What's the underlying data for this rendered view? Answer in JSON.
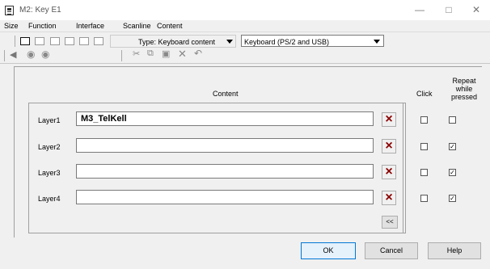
{
  "window": {
    "title": "M2: Key E1",
    "minimize": "—",
    "maximize": "□",
    "close": "✕"
  },
  "menu": {
    "size": "Size",
    "function": "Function",
    "interface": "Interface",
    "scanline": "Scanline",
    "content": "Content"
  },
  "toolbar": {
    "type_label": "Type: Keyboard content",
    "keyboard_select": "Keyboard (PS/2 and USB)"
  },
  "headers": {
    "content": "Content",
    "click": "Click",
    "repeat": "Repeat while pressed"
  },
  "layers": [
    {
      "label": "Layer1",
      "value": "M3_TelKell",
      "click": false,
      "repeat": false
    },
    {
      "label": "Layer2",
      "value": "",
      "click": false,
      "repeat": true
    },
    {
      "label": "Layer3",
      "value": "",
      "click": false,
      "repeat": true
    },
    {
      "label": "Layer4",
      "value": "",
      "click": false,
      "repeat": true
    }
  ],
  "buttons": {
    "collapse": "<<",
    "ok": "OK",
    "cancel": "Cancel",
    "help": "Help"
  },
  "icons": {
    "app": "app-icon",
    "delete": "x-icon"
  }
}
